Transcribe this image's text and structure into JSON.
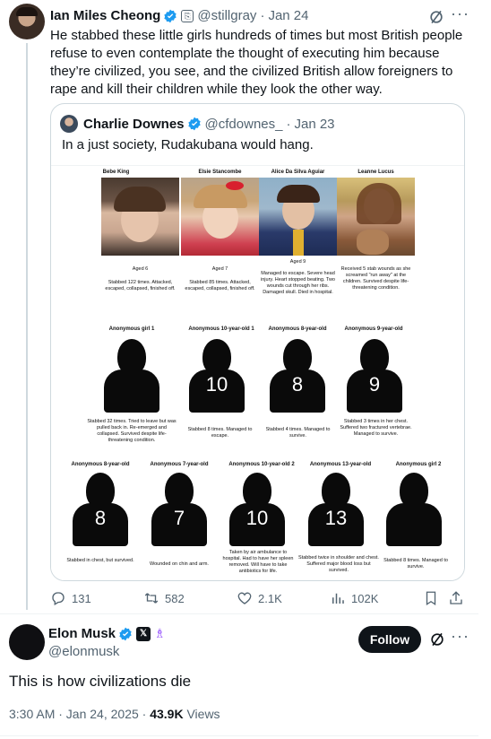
{
  "tweet1": {
    "author_name": "Ian Miles Cheong",
    "author_handle": "@stillgray",
    "date": "Jan 24",
    "text": "He stabbed these little girls hundreds of times but most British people refuse to even contemplate the thought of executing him because they’re civilized, you see, and the civilized British allow foreigners to rape and kill their children while they look the other way.",
    "quote": {
      "author_name": "Charlie Downes",
      "author_handle": "@cfdownes_",
      "date": "Jan 23",
      "text": "In a just society, Rudakubana would hang.",
      "infographic": {
        "row1": [
          {
            "name": "Bebe King",
            "age": "Aged 6",
            "desc": "Stabbed 122 times. Attacked, escaped, collapsed, finished off."
          },
          {
            "name": "Elsie Stancombe",
            "age": "Aged 7",
            "desc": "Stabbed 85 times. Attacked, escaped, collapsed, finished off."
          },
          {
            "name": "Alice Da Silva Aguiar",
            "age": "Aged 9",
            "desc": "Managed to escape. Severe head injury. Heart stopped beating. Two wounds cut through her ribs. Damaged skull. Died in hospital."
          },
          {
            "name": "Leanne Lucus",
            "age": "",
            "desc": "Received 5 stab wounds as she screamed \"run away\" at the children. Survived despite life-threatening condition."
          }
        ],
        "row2": [
          {
            "name": "Anonymous girl 1",
            "num": "",
            "desc": "Stabbed 32 times. Tried to leave but was pulled back in. Re-emerged and collapsed. Survived despite life-threatening condition."
          },
          {
            "name": "Anonymous 10-year-old 1",
            "num": "10",
            "desc": "Stabbed 8 times. Managed to escape."
          },
          {
            "name": "Anonymous 8-year-old",
            "num": "8",
            "desc": "Stabbed 4 times. Managed to survive."
          },
          {
            "name": "Anonymous 9-year-old",
            "num": "9",
            "desc": "Stabbed 3 times in her chest. Suffered two fractured vertebrae. Managed to survive."
          }
        ],
        "row3": [
          {
            "name": "Anonymous 8-year-old",
            "num": "8",
            "desc": "Stabbed in chest, but survived."
          },
          {
            "name": "Anonymous 7-year-old",
            "num": "7",
            "desc": "Wounded on chin and arm."
          },
          {
            "name": "Anonymous 10-year-old 2",
            "num": "10",
            "desc": "Taken by air ambulance to hospital. Had to have her spleen removed. Will have to take antibiotics for life."
          },
          {
            "name": "Anonymous 13-year-old",
            "num": "13",
            "desc": "Stabbed twice in shoulder and chest. Suffered major blood loss but survived."
          },
          {
            "name": "Anonymous girl 2",
            "num": "",
            "desc": "Stabbed 8 times. Managed to survive."
          }
        ]
      }
    },
    "actions": {
      "replies": "131",
      "reposts": "582",
      "likes": "2.1K",
      "views": "102K"
    }
  },
  "tweet2": {
    "author_name": "Elon Musk",
    "author_handle": "@elonmusk",
    "follow_label": "Follow",
    "text": "This is how civilizations die",
    "time": "3:30 AM · Jan 24, 2025 · ",
    "views_count": "43.9K",
    "views_label": " Views"
  },
  "colors": {
    "verified_blue": "#1d9bf0",
    "muted": "#536471",
    "text": "#0f1419",
    "affiliation_purple": "#8a3ffc"
  },
  "icons": [
    "verified-icon",
    "grok-icon",
    "more-icon",
    "reply-icon",
    "repost-icon",
    "like-icon",
    "views-icon",
    "bookmark-icon",
    "share-icon",
    "x-badge-icon",
    "affiliation-icon"
  ]
}
